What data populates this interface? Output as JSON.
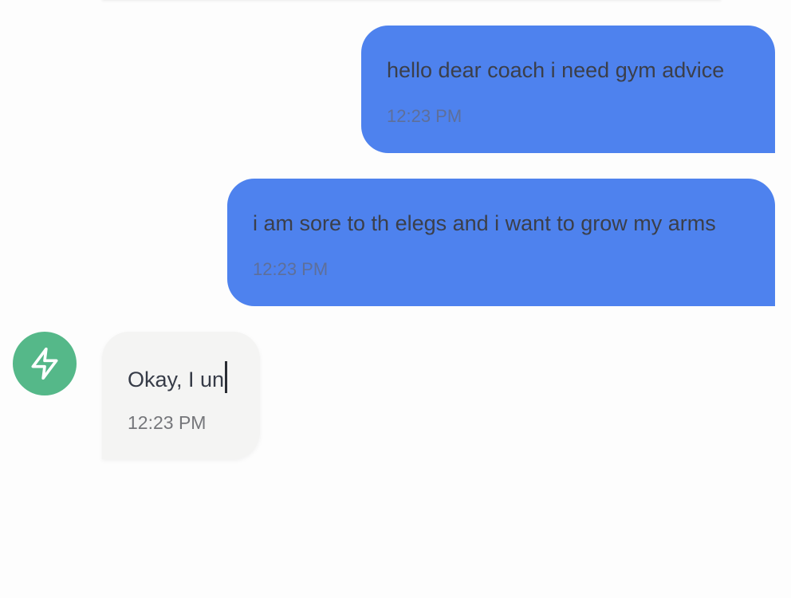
{
  "messages": [
    {
      "sender": "user",
      "text": "hello dear coach i need gym advice",
      "time": "12:23 PM"
    },
    {
      "sender": "user",
      "text": "i am sore to th elegs and i want to grow my arms",
      "time": "12:23 PM"
    },
    {
      "sender": "assistant",
      "text": "Okay, I un",
      "time": "12:23 PM",
      "avatar_icon": "lightning-bolt-icon"
    }
  ],
  "colors": {
    "user_bubble": "#4e82ee",
    "assistant_bubble": "#f4f4f3",
    "avatar": "#55b889"
  }
}
